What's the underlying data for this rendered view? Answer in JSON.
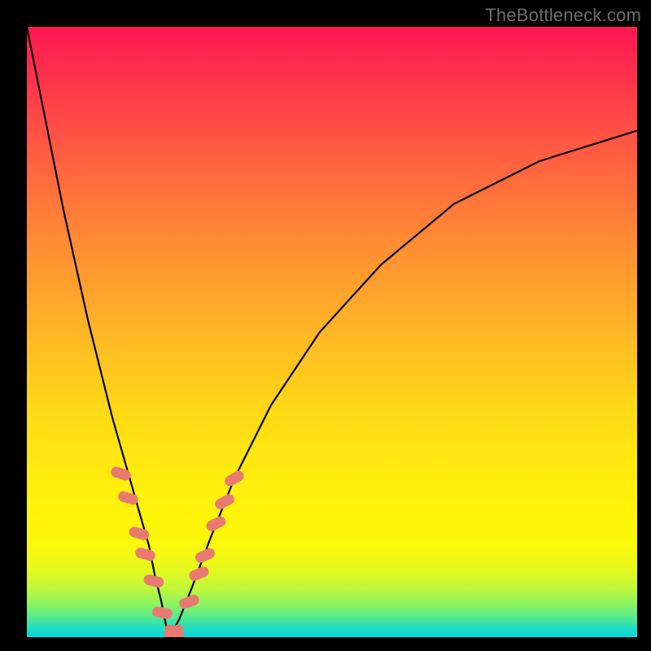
{
  "watermark": "TheBottleneck.com",
  "colors": {
    "frame": "#000000",
    "curve": "#000000",
    "bead": "#e97a71"
  },
  "chart_data": {
    "type": "line",
    "title": "",
    "xlabel": "",
    "ylabel": "",
    "xlim": [
      0,
      100
    ],
    "ylim": [
      0,
      100
    ],
    "series": [
      {
        "name": "left-curve",
        "x": [
          0,
          2,
          4,
          6,
          8,
          10,
          12,
          14,
          16,
          18,
          20,
          21,
          22,
          22.8,
          23.4
        ],
        "y": [
          100,
          90,
          80,
          70,
          61,
          52,
          44,
          36,
          29,
          22,
          15,
          10,
          6,
          2,
          0
        ]
      },
      {
        "name": "right-curve",
        "x": [
          23.4,
          25,
          27,
          30,
          34,
          40,
          48,
          58,
          70,
          84,
          100
        ],
        "y": [
          0,
          3,
          8,
          16,
          26,
          38,
          50,
          61,
          71,
          78,
          83
        ]
      }
    ],
    "beads": [
      {
        "x": 15.4,
        "y": 26.8,
        "angle": -72
      },
      {
        "x": 16.6,
        "y": 22.8,
        "angle": -72
      },
      {
        "x": 18.4,
        "y": 17.0,
        "angle": -74
      },
      {
        "x": 19.4,
        "y": 13.6,
        "angle": -74
      },
      {
        "x": 20.8,
        "y": 9.2,
        "angle": -76
      },
      {
        "x": 22.2,
        "y": 4.0,
        "angle": -80
      },
      {
        "x": 23.4,
        "y": 0.4,
        "angle": 0
      },
      {
        "x": 24.8,
        "y": 0.4,
        "angle": 0
      },
      {
        "x": 26.6,
        "y": 5.8,
        "angle": 70
      },
      {
        "x": 28.2,
        "y": 10.4,
        "angle": 68
      },
      {
        "x": 29.2,
        "y": 13.4,
        "angle": 66
      },
      {
        "x": 31.0,
        "y": 18.6,
        "angle": 64
      },
      {
        "x": 32.4,
        "y": 22.2,
        "angle": 62
      },
      {
        "x": 34.0,
        "y": 26.0,
        "angle": 60
      }
    ]
  }
}
